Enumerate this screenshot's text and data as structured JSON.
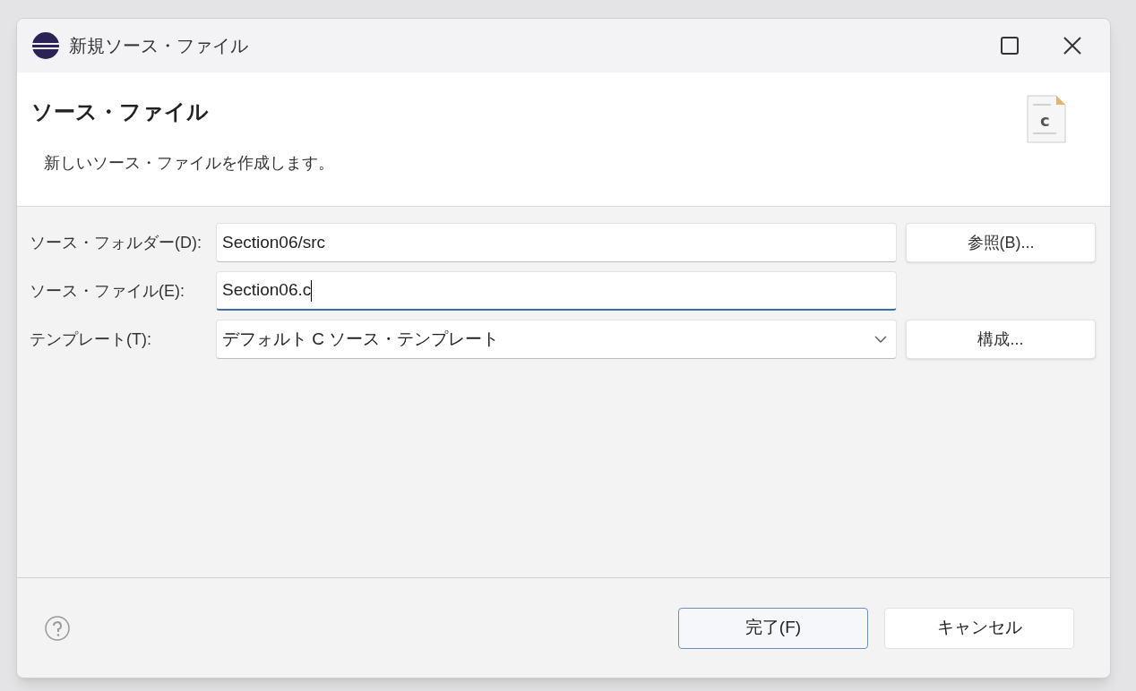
{
  "window": {
    "title": "新規ソース・ファイル"
  },
  "header": {
    "title": "ソース・ファイル",
    "description": "新しいソース・ファイルを作成します。",
    "icon_letter": "c"
  },
  "fields": [
    {
      "kind": "text",
      "label": "ソース・フォルダー(D):",
      "value": "Section06/src",
      "focused": false,
      "button": "参照(B)..."
    },
    {
      "kind": "text",
      "label": "ソース・ファイル(E):",
      "value": "Section06.c",
      "focused": true
    },
    {
      "kind": "select",
      "label": "テンプレート(T):",
      "value": "デフォルト C ソース・テンプレート",
      "focused": false,
      "button": "構成..."
    }
  ],
  "buttons": [
    {
      "label": "完了(F)",
      "default": true
    },
    {
      "label": "キャンセル",
      "default": false
    }
  ]
}
